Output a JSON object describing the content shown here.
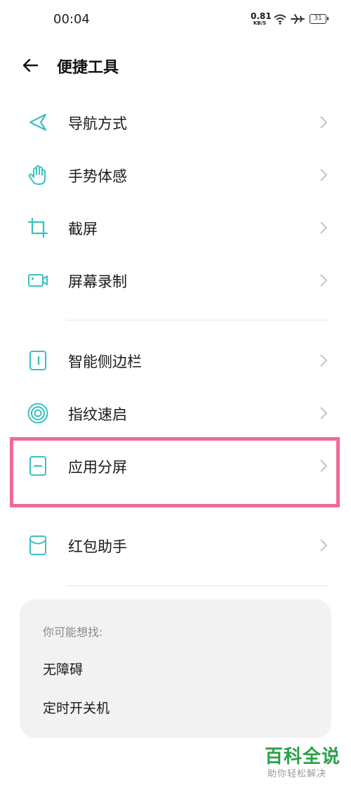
{
  "status_bar": {
    "time": "00:04",
    "net_speed": "0.81",
    "net_speed_unit": "KB/S",
    "battery": "31",
    "icons": [
      "wifi-icon",
      "airplane-mode-icon",
      "battery-icon"
    ]
  },
  "header": {
    "title": "便捷工具",
    "back_icon": "back-arrow-icon"
  },
  "accent_color": "#3cc0c0",
  "highlight_color": "#f0699a",
  "menu": {
    "items": [
      {
        "label": "导航方式",
        "icon": "navigation-icon"
      },
      {
        "label": "手势体感",
        "icon": "hand-gesture-icon"
      },
      {
        "label": "截屏",
        "icon": "crop-icon"
      },
      {
        "label": "屏幕录制",
        "icon": "screen-record-icon"
      },
      {
        "label": "智能侧边栏",
        "icon": "sidebar-icon"
      },
      {
        "label": "指纹速启",
        "icon": "fingerprint-icon"
      },
      {
        "label": "应用分屏",
        "icon": "split-screen-icon"
      },
      {
        "label": "红包助手",
        "icon": "red-packet-icon"
      }
    ]
  },
  "suggestions": {
    "heading": "你可能想找:",
    "items": [
      "无障碍",
      "定时开关机"
    ]
  },
  "watermark": {
    "main": "百科全说",
    "sub": "助你轻松解决"
  }
}
